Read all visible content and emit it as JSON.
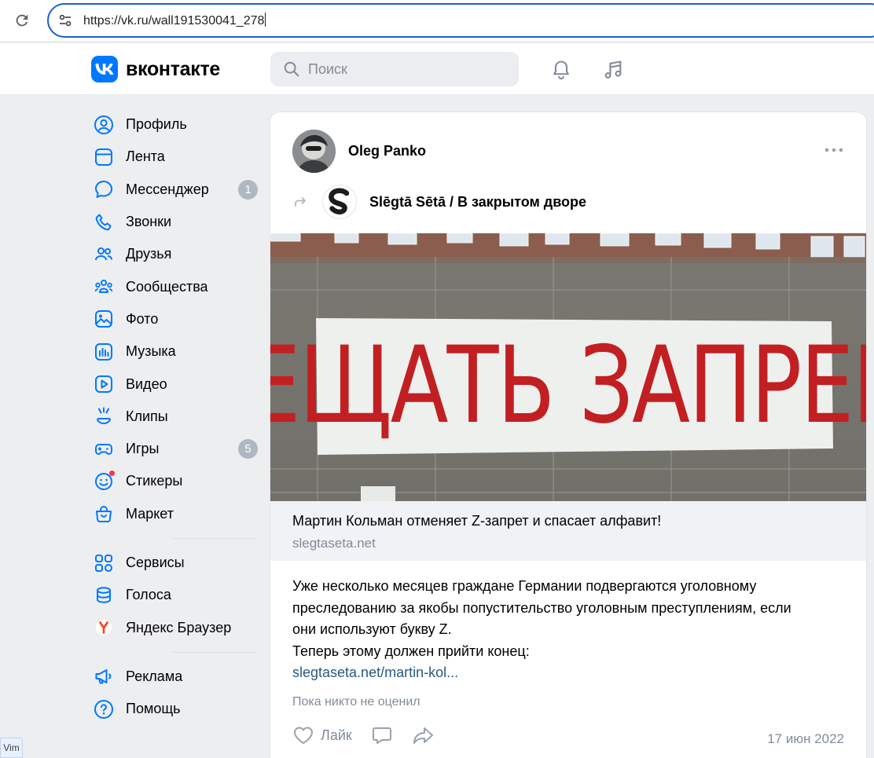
{
  "browser": {
    "url": "https://vk.ru/wall191530041_278"
  },
  "header": {
    "logo_text": "вконтакте",
    "search_placeholder": "Поиск",
    "icons": [
      "bell-icon",
      "music-icon"
    ]
  },
  "sidebar": {
    "items": [
      {
        "label": "Профиль",
        "icon": "profile-icon"
      },
      {
        "label": "Лента",
        "icon": "feed-icon"
      },
      {
        "label": "Мессенджер",
        "icon": "messenger-icon",
        "badge": "1"
      },
      {
        "label": "Звонки",
        "icon": "phone-icon"
      },
      {
        "label": "Друзья",
        "icon": "friends-icon"
      },
      {
        "label": "Сообщества",
        "icon": "communities-icon"
      },
      {
        "label": "Фото",
        "icon": "photo-icon"
      },
      {
        "label": "Музыка",
        "icon": "music-icon"
      },
      {
        "label": "Видео",
        "icon": "video-icon"
      },
      {
        "label": "Клипы",
        "icon": "clips-icon"
      },
      {
        "label": "Игры",
        "icon": "games-icon",
        "badge": "5"
      },
      {
        "label": "Стикеры",
        "icon": "stickers-icon"
      },
      {
        "label": "Маркет",
        "icon": "market-icon"
      }
    ],
    "items2": [
      {
        "label": "Сервисы",
        "icon": "services-icon"
      },
      {
        "label": "Голоса",
        "icon": "votes-icon"
      },
      {
        "label": "Яндекс Браузер",
        "icon": "yandex-browser-icon"
      }
    ],
    "items3": [
      {
        "label": "Реклама",
        "icon": "ads-icon"
      },
      {
        "label": "Помощь",
        "icon": "help-icon"
      }
    ]
  },
  "post": {
    "author": "Oleg Panko",
    "source": "Slēgtā Sētā / В закрытом дворе",
    "image_text": "ЗАПРЕЩАТЬ ЗАПРЕЩЕНО",
    "link": {
      "title": "Мартин Кольман отменяет Z-запрет и спасает алфавит!",
      "domain": "slegtaseta.net"
    },
    "text_lines": [
      "Уже несколько месяцев граждане Германии подвергаются уголовному",
      "преследованию за якобы попустительство уголовным преступлениям, если",
      "они используют букву Z.",
      "Теперь этому должен прийти конец:"
    ],
    "text_link": "slegtaseta.net/martin-kol...",
    "likes_info": "Пока никто не оценил",
    "like_label": "Лайк",
    "date": "17 июн 2022"
  },
  "overlay": {
    "vim_tag": "Vim"
  },
  "colors": {
    "accent": "#0077ff",
    "link": "#2a5885",
    "secondary_text": "#818c99",
    "badge": "#aeb7c2",
    "background": "#edeef0"
  }
}
